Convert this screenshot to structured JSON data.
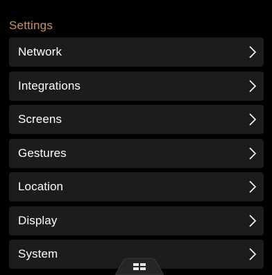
{
  "header": {
    "title": "Settings"
  },
  "menu": {
    "items": [
      {
        "label": "Network"
      },
      {
        "label": "Integrations"
      },
      {
        "label": "Screens"
      },
      {
        "label": "Gestures"
      },
      {
        "label": "Location"
      },
      {
        "label": "Display"
      },
      {
        "label": "System"
      }
    ]
  },
  "colors": {
    "accent": "#c9935a",
    "item_background": "#1c1c1c",
    "text": "#ffffff",
    "background": "#000000"
  },
  "icons": {
    "chevron": "chevron-right-icon",
    "dock": "grid-icon"
  }
}
